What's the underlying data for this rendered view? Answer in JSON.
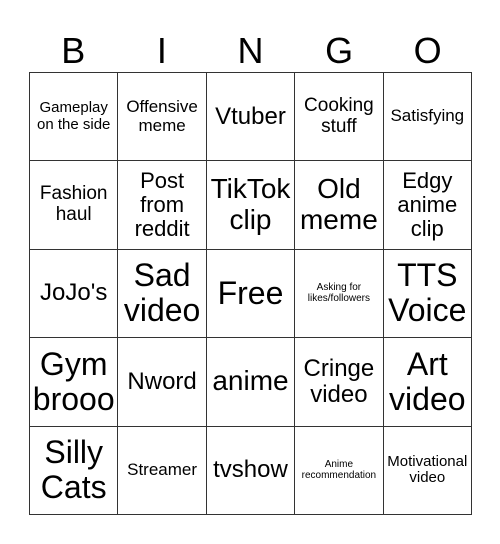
{
  "header": [
    "B",
    "I",
    "N",
    "G",
    "O"
  ],
  "cells": [
    "Gameplay on the side",
    "Offensive meme",
    "Vtuber",
    "Cooking stuff",
    "Satisfying",
    "Fashion haul",
    "Post from reddit",
    "TikTok clip",
    "Old meme",
    "Edgy anime clip",
    "JoJo's",
    "Sad video",
    "Free",
    "Asking for likes/followers",
    "TTS Voice",
    "Gym brooo",
    "Nword",
    "anime",
    "Cringe video",
    "Art video",
    "Silly Cats",
    "Streamer",
    "tvshow",
    "Anime recommendation",
    "Motivational video"
  ]
}
